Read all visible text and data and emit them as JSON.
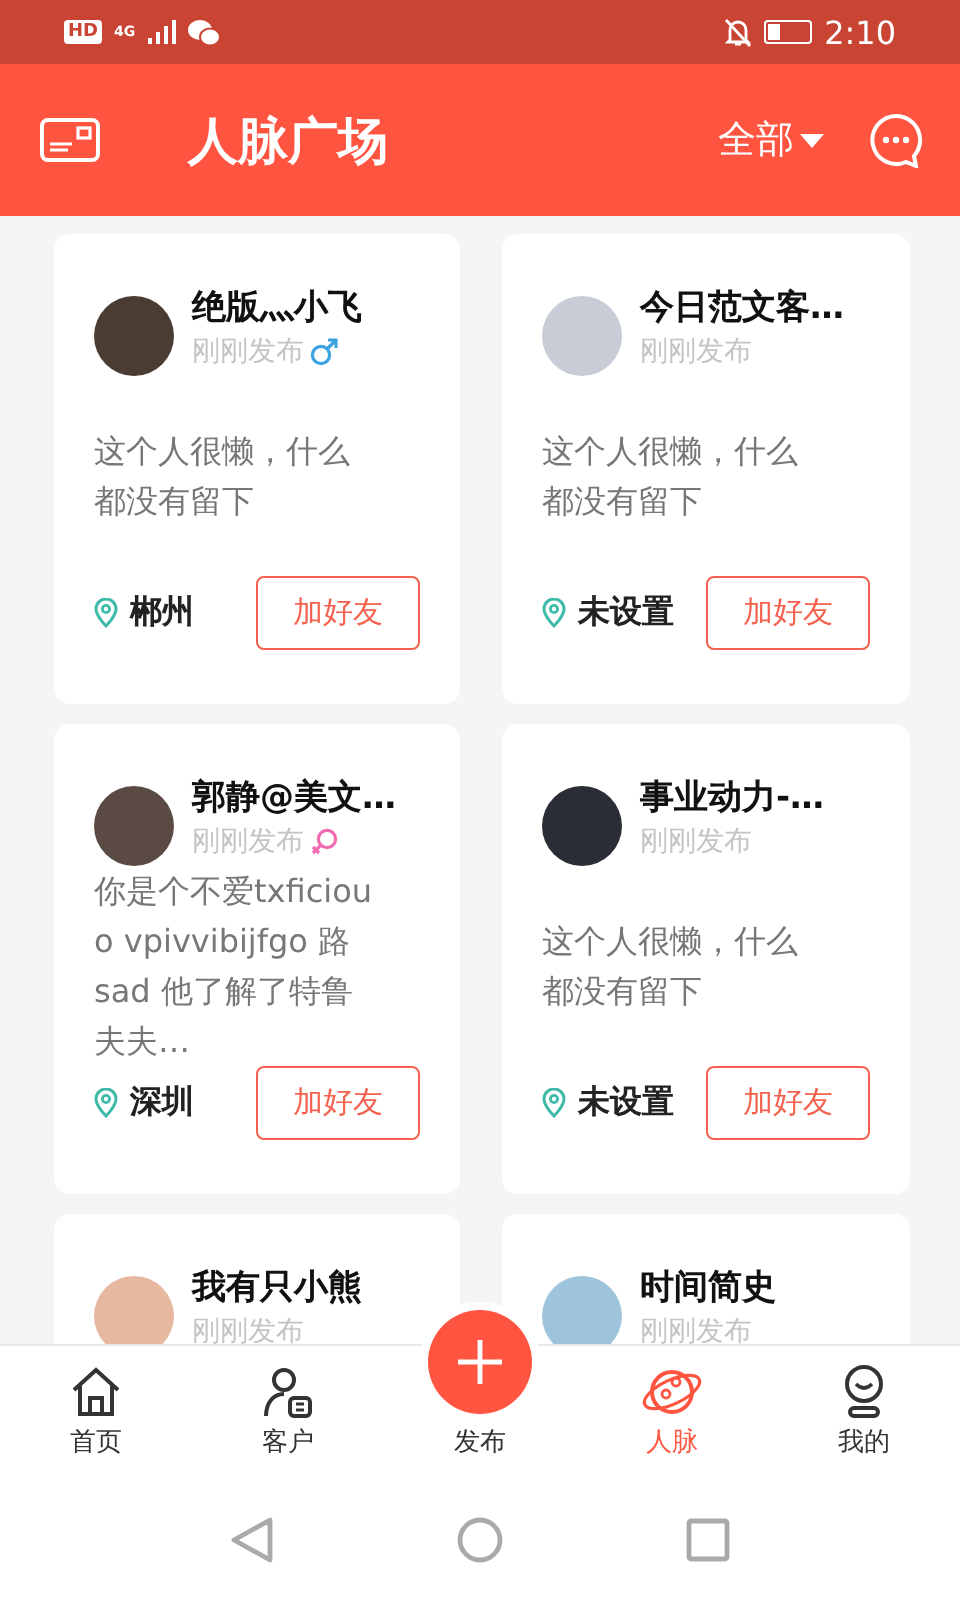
{
  "status_bar": {
    "hd_badge": "HD",
    "network": "4G",
    "time": "2:10"
  },
  "header": {
    "title": "人脉广场",
    "filter": "全部"
  },
  "cards": [
    {
      "kind": "male",
      "name": "绝版灬小飞",
      "time": "刚刚发布",
      "bio": "这个人很懒，什么都没有留下",
      "city": "郴州",
      "button": "加好友"
    },
    {
      "kind": "plain",
      "name": "今日范文客…",
      "time": "刚刚发布",
      "bio": "这个人很懒，什么都没有留下",
      "city": "未设置",
      "button": "加好友"
    },
    {
      "kind": "female",
      "name": "郭静@美文…",
      "time": "刚刚发布",
      "bio": "你是个不爱txficiouo vpivvibijfgo 路 sad 他了解了特鲁夫夫…",
      "city": "深圳",
      "button": "加好友"
    },
    {
      "kind": "plain",
      "name": "事业动力-…",
      "time": "刚刚发布",
      "bio": "这个人很懒，什么都没有留下",
      "city": "未设置",
      "button": "加好友"
    },
    {
      "kind": "plain",
      "name": "我有只小熊",
      "time": "刚刚发布"
    },
    {
      "kind": "plain",
      "name": "时间简史",
      "time": "刚刚发布"
    }
  ],
  "tabs": [
    {
      "kind": "home",
      "label": "首页",
      "selected": false
    },
    {
      "kind": "client",
      "label": "客户",
      "selected": false
    },
    {
      "kind": "publish",
      "label": "发布",
      "selected": false
    },
    {
      "kind": "network",
      "label": "人脉",
      "selected": true
    },
    {
      "kind": "me",
      "label": "我的",
      "selected": false
    }
  ]
}
